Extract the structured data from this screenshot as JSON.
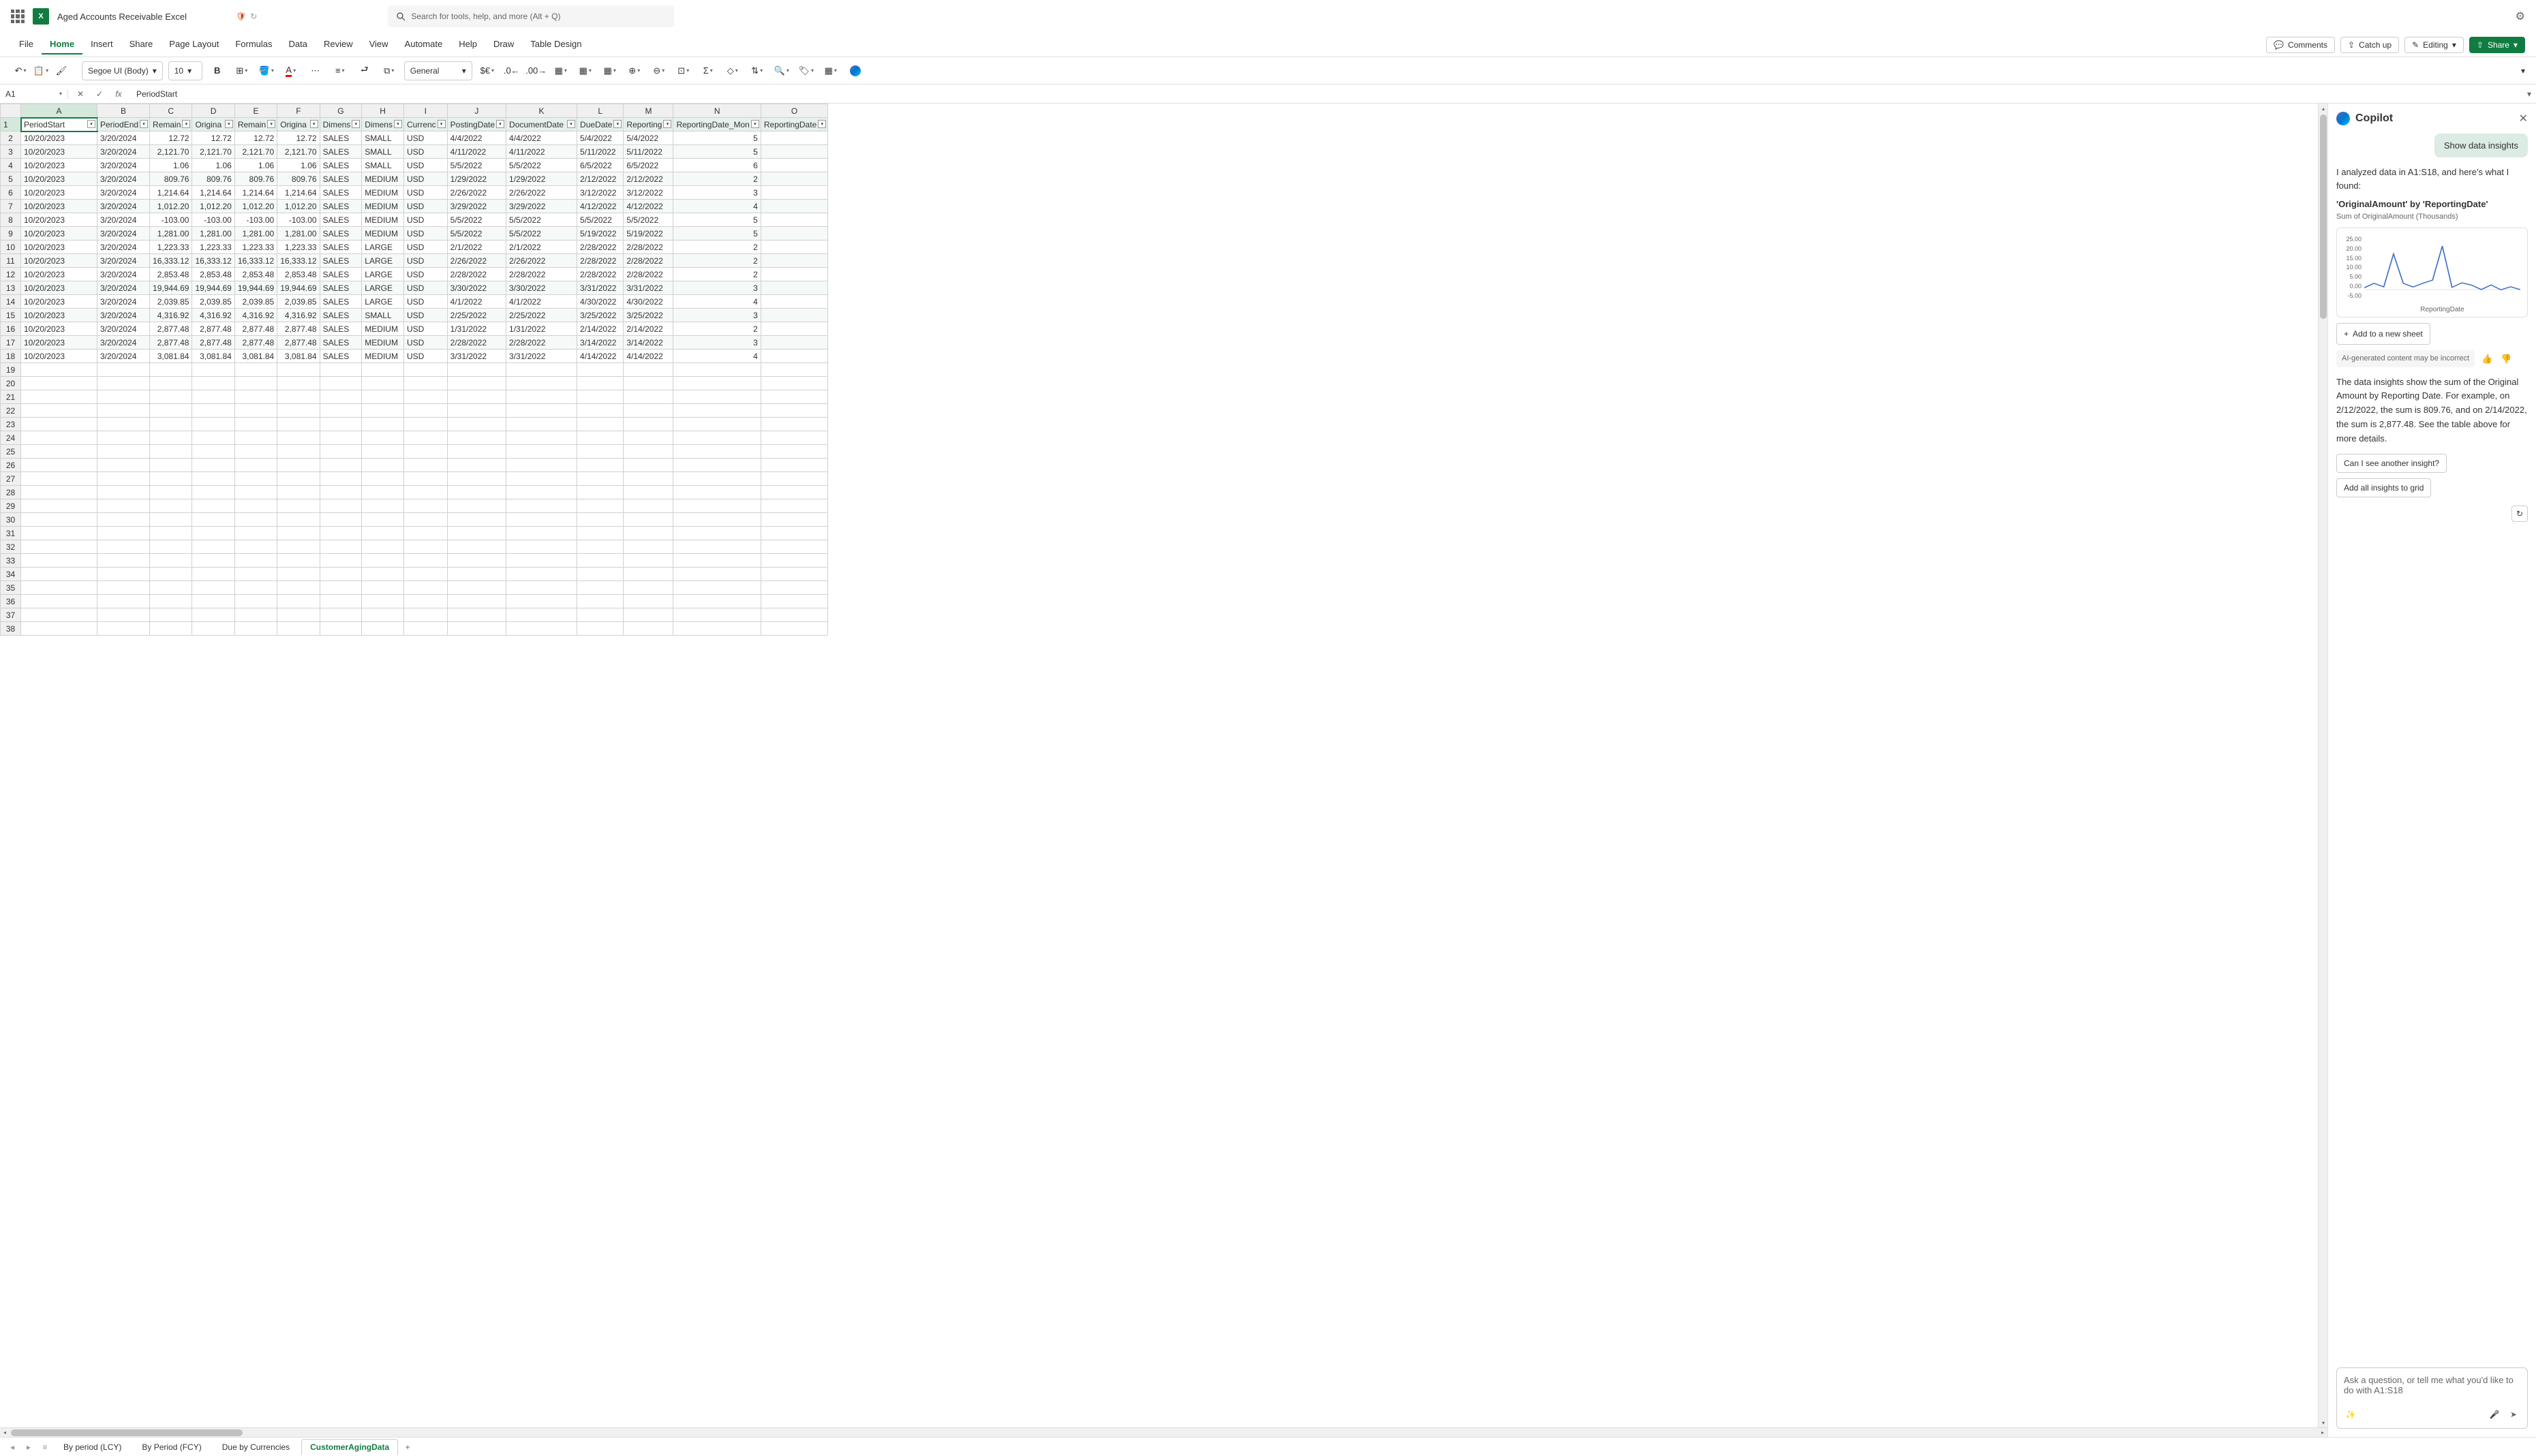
{
  "topbar": {
    "doc_title": "Aged Accounts Receivable Excel",
    "search_placeholder": "Search for tools, help, and more (Alt + Q)"
  },
  "ribbon_tabs": [
    "File",
    "Home",
    "Insert",
    "Share",
    "Page Layout",
    "Formulas",
    "Data",
    "Review",
    "View",
    "Automate",
    "Help",
    "Draw",
    "Table Design"
  ],
  "ribbon_active": 1,
  "ribbon_right": {
    "comments": "Comments",
    "catchup": "Catch up",
    "editing": "Editing",
    "share": "Share"
  },
  "toolbar": {
    "font_name": "Segoe UI (Body)",
    "font_size": "10",
    "number_format": "General"
  },
  "name_box": "A1",
  "formula_value": "PeriodStart",
  "columns": [
    "A",
    "B",
    "C",
    "D",
    "E",
    "F",
    "G",
    "H",
    "I",
    "J",
    "K",
    "L",
    "M",
    "N",
    "O"
  ],
  "headers": [
    "PeriodStart",
    "PeriodEnd",
    "Remain",
    "Origina",
    "Remain",
    "Origina",
    "Dimens",
    "Dimens",
    "Currenc",
    "PostingDate",
    "DocumentDate",
    "DueDate",
    "Reporting",
    "ReportingDate_Mon",
    "ReportingDate"
  ],
  "rows": [
    [
      "10/20/2023",
      "3/20/2024",
      "12.72",
      "12.72",
      "12.72",
      "12.72",
      "SALES",
      "SMALL",
      "USD",
      "4/4/2022",
      "4/4/2022",
      "5/4/2022",
      "5/4/2022",
      "5",
      ""
    ],
    [
      "10/20/2023",
      "3/20/2024",
      "2,121.70",
      "2,121.70",
      "2,121.70",
      "2,121.70",
      "SALES",
      "SMALL",
      "USD",
      "4/11/2022",
      "4/11/2022",
      "5/11/2022",
      "5/11/2022",
      "5",
      ""
    ],
    [
      "10/20/2023",
      "3/20/2024",
      "1.06",
      "1.06",
      "1.06",
      "1.06",
      "SALES",
      "SMALL",
      "USD",
      "5/5/2022",
      "5/5/2022",
      "6/5/2022",
      "6/5/2022",
      "6",
      ""
    ],
    [
      "10/20/2023",
      "3/20/2024",
      "809.76",
      "809.76",
      "809.76",
      "809.76",
      "SALES",
      "MEDIUM",
      "USD",
      "1/29/2022",
      "1/29/2022",
      "2/12/2022",
      "2/12/2022",
      "2",
      ""
    ],
    [
      "10/20/2023",
      "3/20/2024",
      "1,214.64",
      "1,214.64",
      "1,214.64",
      "1,214.64",
      "SALES",
      "MEDIUM",
      "USD",
      "2/26/2022",
      "2/26/2022",
      "3/12/2022",
      "3/12/2022",
      "3",
      ""
    ],
    [
      "10/20/2023",
      "3/20/2024",
      "1,012.20",
      "1,012.20",
      "1,012.20",
      "1,012.20",
      "SALES",
      "MEDIUM",
      "USD",
      "3/29/2022",
      "3/29/2022",
      "4/12/2022",
      "4/12/2022",
      "4",
      ""
    ],
    [
      "10/20/2023",
      "3/20/2024",
      "-103.00",
      "-103.00",
      "-103.00",
      "-103.00",
      "SALES",
      "MEDIUM",
      "USD",
      "5/5/2022",
      "5/5/2022",
      "5/5/2022",
      "5/5/2022",
      "5",
      ""
    ],
    [
      "10/20/2023",
      "3/20/2024",
      "1,281.00",
      "1,281.00",
      "1,281.00",
      "1,281.00",
      "SALES",
      "MEDIUM",
      "USD",
      "5/5/2022",
      "5/5/2022",
      "5/19/2022",
      "5/19/2022",
      "5",
      ""
    ],
    [
      "10/20/2023",
      "3/20/2024",
      "1,223.33",
      "1,223.33",
      "1,223.33",
      "1,223.33",
      "SALES",
      "LARGE",
      "USD",
      "2/1/2022",
      "2/1/2022",
      "2/28/2022",
      "2/28/2022",
      "2",
      ""
    ],
    [
      "10/20/2023",
      "3/20/2024",
      "16,333.12",
      "16,333.12",
      "16,333.12",
      "16,333.12",
      "SALES",
      "LARGE",
      "USD",
      "2/26/2022",
      "2/26/2022",
      "2/28/2022",
      "2/28/2022",
      "2",
      ""
    ],
    [
      "10/20/2023",
      "3/20/2024",
      "2,853.48",
      "2,853.48",
      "2,853.48",
      "2,853.48",
      "SALES",
      "LARGE",
      "USD",
      "2/28/2022",
      "2/28/2022",
      "2/28/2022",
      "2/28/2022",
      "2",
      ""
    ],
    [
      "10/20/2023",
      "3/20/2024",
      "19,944.69",
      "19,944.69",
      "19,944.69",
      "19,944.69",
      "SALES",
      "LARGE",
      "USD",
      "3/30/2022",
      "3/30/2022",
      "3/31/2022",
      "3/31/2022",
      "3",
      ""
    ],
    [
      "10/20/2023",
      "3/20/2024",
      "2,039.85",
      "2,039.85",
      "2,039.85",
      "2,039.85",
      "SALES",
      "LARGE",
      "USD",
      "4/1/2022",
      "4/1/2022",
      "4/30/2022",
      "4/30/2022",
      "4",
      ""
    ],
    [
      "10/20/2023",
      "3/20/2024",
      "4,316.92",
      "4,316.92",
      "4,316.92",
      "4,316.92",
      "SALES",
      "SMALL",
      "USD",
      "2/25/2022",
      "2/25/2022",
      "3/25/2022",
      "3/25/2022",
      "3",
      ""
    ],
    [
      "10/20/2023",
      "3/20/2024",
      "2,877.48",
      "2,877.48",
      "2,877.48",
      "2,877.48",
      "SALES",
      "MEDIUM",
      "USD",
      "1/31/2022",
      "1/31/2022",
      "2/14/2022",
      "2/14/2022",
      "2",
      ""
    ],
    [
      "10/20/2023",
      "3/20/2024",
      "2,877.48",
      "2,877.48",
      "2,877.48",
      "2,877.48",
      "SALES",
      "MEDIUM",
      "USD",
      "2/28/2022",
      "2/28/2022",
      "3/14/2022",
      "3/14/2022",
      "3",
      ""
    ],
    [
      "10/20/2023",
      "3/20/2024",
      "3,081.84",
      "3,081.84",
      "3,081.84",
      "3,081.84",
      "SALES",
      "MEDIUM",
      "USD",
      "3/31/2022",
      "3/31/2022",
      "4/14/2022",
      "4/14/2022",
      "4",
      ""
    ]
  ],
  "empty_rows": 20,
  "text_cols": [
    0,
    1,
    6,
    7,
    8,
    9,
    10,
    11,
    12
  ],
  "copilot": {
    "title": "Copilot",
    "user_msg": "Show data insights",
    "intro": "I analyzed data in A1:S18, and here's what I found:",
    "chart_title": "'OriginalAmount' by 'ReportingDate'",
    "chart_sub": "Sum of OriginalAmount (Thousands)",
    "chart_xlabel": "ReportingDate",
    "add_sheet": "Add to a new sheet",
    "disclaimer": "AI-generated content may be incorrect",
    "explain": "The data insights show the sum of the Original Amount by Reporting Date. For example, on 2/12/2022, the sum is 809.76, and on 2/14/2022, the sum is 2,877.48. See the table above for more details.",
    "sugg1": "Can I see another insight?",
    "sugg2": "Add all insights to grid",
    "input_placeholder": "Ask a question, or tell me what you'd like to do with A1:S18"
  },
  "chart_data": {
    "type": "line",
    "title": "'OriginalAmount' by 'ReportingDate'",
    "ylabel": "Sum of OriginalAmount (Thousands)",
    "xlabel": "ReportingDate",
    "ylim": [
      -5,
      25
    ],
    "yticks": [
      "25.00",
      "20.00",
      "15.00",
      "10.00",
      "5.00",
      "0.00",
      "-5.00"
    ],
    "series": [
      {
        "name": "OriginalAmount",
        "values": [
          0.81,
          2.88,
          1.22,
          16.33,
          2.85,
          1.21,
          2.88,
          4.32,
          19.94,
          1.01,
          3.08,
          2.04,
          0.01,
          2.12,
          -0.1,
          1.28,
          0.0
        ]
      }
    ]
  },
  "sheet_tabs": [
    "By period (LCY)",
    "By Period (FCY)",
    "Due by Currencies",
    "CustomerAgingData"
  ],
  "sheet_active": 3
}
